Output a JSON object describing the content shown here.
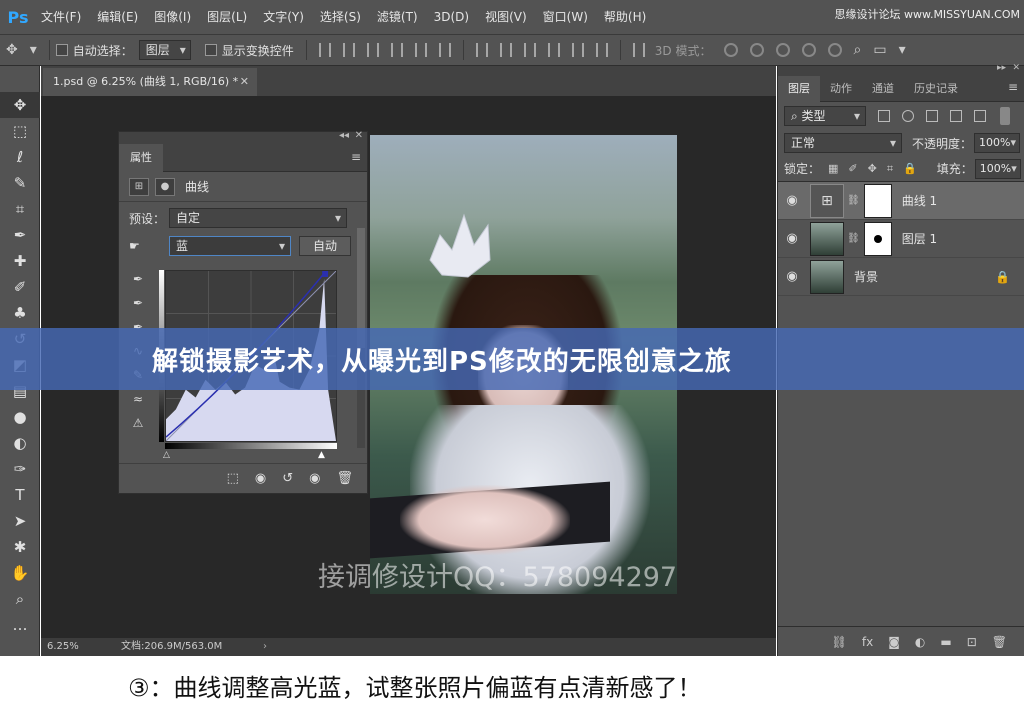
{
  "app": {
    "logo": "Ps"
  },
  "menubar": {
    "items": [
      "文件(F)",
      "编辑(E)",
      "图像(I)",
      "图层(L)",
      "文字(Y)",
      "选择(S)",
      "滤镜(T)",
      "3D(D)",
      "视图(V)",
      "窗口(W)",
      "帮助(H)"
    ],
    "watermark": "思缘设计论坛 www.MISSYUAN.COM"
  },
  "options": {
    "auto_select_label": "自动选择：",
    "auto_select_value": "图层",
    "show_transform_label": "显示变换控件",
    "threed_mode_label": "3D 模式："
  },
  "document": {
    "tab_title": "1.psd @ 6.25% (曲线 1, RGB/16) *",
    "zoom": "6.25%",
    "doc_info": "文档:206.9M/563.0M"
  },
  "properties": {
    "tab": "属性",
    "type_label": "曲线",
    "preset_label": "预设：",
    "preset_value": "自定",
    "channel_value": "蓝",
    "auto_label": "自动"
  },
  "layers_panel": {
    "tabs": [
      "图层",
      "动作",
      "通道",
      "历史记录"
    ],
    "filter_value": "类型",
    "blend_mode": "正常",
    "opacity_label": "不透明度：",
    "opacity_value": "100%",
    "lock_label": "锁定：",
    "fill_label": "填充：",
    "fill_value": "100%",
    "layers": [
      {
        "name": "曲线 1",
        "selected": true
      },
      {
        "name": "图层 1",
        "selected": false
      },
      {
        "name": "背景",
        "selected": false
      }
    ]
  },
  "overlay": {
    "banner": "解锁摄影艺术，从曝光到PS修改的无限创意之旅",
    "qq_watermark": "接调修设计QQ：578094297",
    "caption": "③：曲线调整高光蓝，试整张照片偏蓝有点清新感了！"
  }
}
